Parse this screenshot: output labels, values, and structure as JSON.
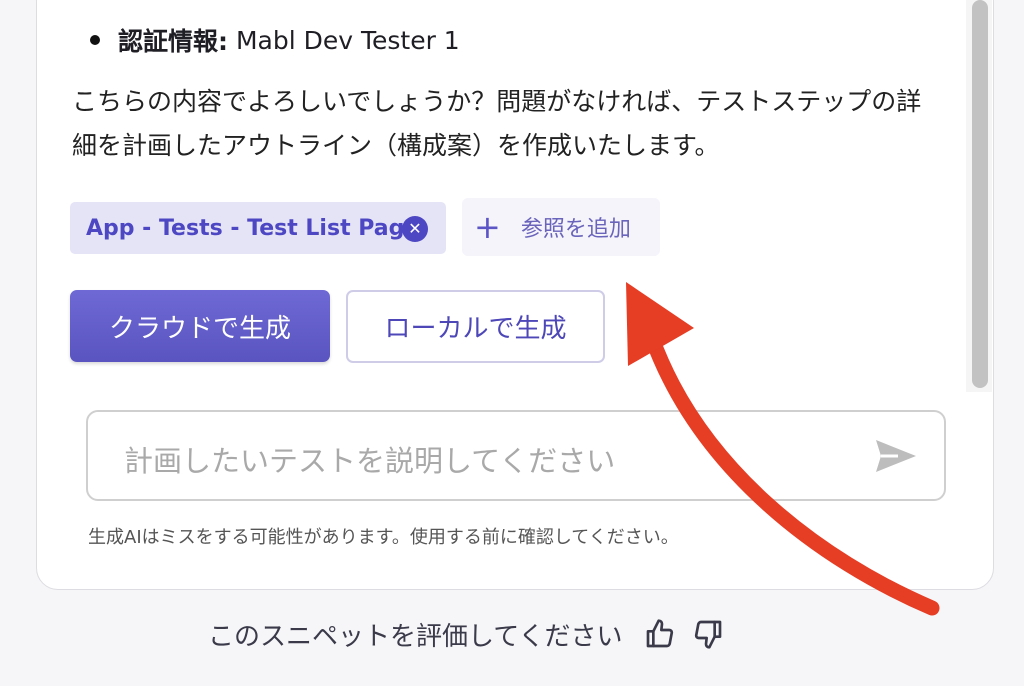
{
  "message": {
    "bullet_key": "認証情報:",
    "bullet_value": " Mabl Dev Tester 1",
    "paragraph": "こちらの内容でよろしいでしょうか？問題がなければ、テストステップの詳細を計画したアウトライン（構成案）を作成いたします。"
  },
  "reference_chip": {
    "label": "App - Tests - Test List Page",
    "close_icon": "close-circle-icon"
  },
  "add_reference": {
    "icon": "plus-icon",
    "label": "参照を追加"
  },
  "actions": {
    "cloud_label": "クラウドで生成",
    "local_label": "ローカルで生成"
  },
  "input": {
    "placeholder": "計画したいテストを説明してください",
    "send_icon": "send-icon"
  },
  "disclaimer": "生成AIはミスをする可能性があります。使用する前に確認してください。",
  "rating": {
    "label": "このスニペットを評価してください",
    "thumbs_up_icon": "thumbs-up-icon",
    "thumbs_down_icon": "thumbs-down-icon"
  },
  "colors": {
    "accent": "#5f5ac8",
    "chip_bg": "#e5e4f6",
    "annotation_arrow": "#e63d25"
  }
}
